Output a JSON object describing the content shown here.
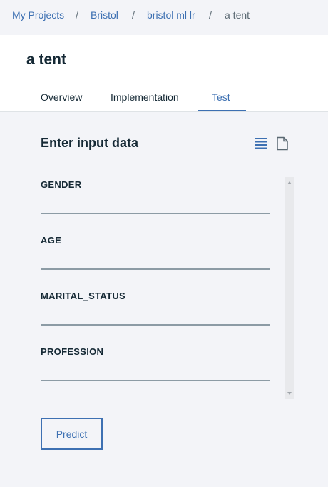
{
  "breadcrumb": {
    "items": [
      "My Projects",
      "Bristol",
      "bristol ml lr"
    ],
    "current": "a tent",
    "separator": "/"
  },
  "header": {
    "title": "a tent",
    "tabs": [
      {
        "label": "Overview",
        "active": false
      },
      {
        "label": "Implementation",
        "active": false
      },
      {
        "label": "Test",
        "active": true
      }
    ]
  },
  "test_panel": {
    "title": "Enter input data",
    "icons": [
      "list-view-icon",
      "document-view-icon"
    ],
    "fields": [
      {
        "label": "GENDER",
        "value": ""
      },
      {
        "label": "AGE",
        "value": ""
      },
      {
        "label": "MARITAL_STATUS",
        "value": ""
      },
      {
        "label": "PROFESSION",
        "value": ""
      }
    ],
    "predict_label": "Predict"
  },
  "colors": {
    "accent": "#3d70b2",
    "background": "#f3f4f8",
    "text": "#152935"
  }
}
